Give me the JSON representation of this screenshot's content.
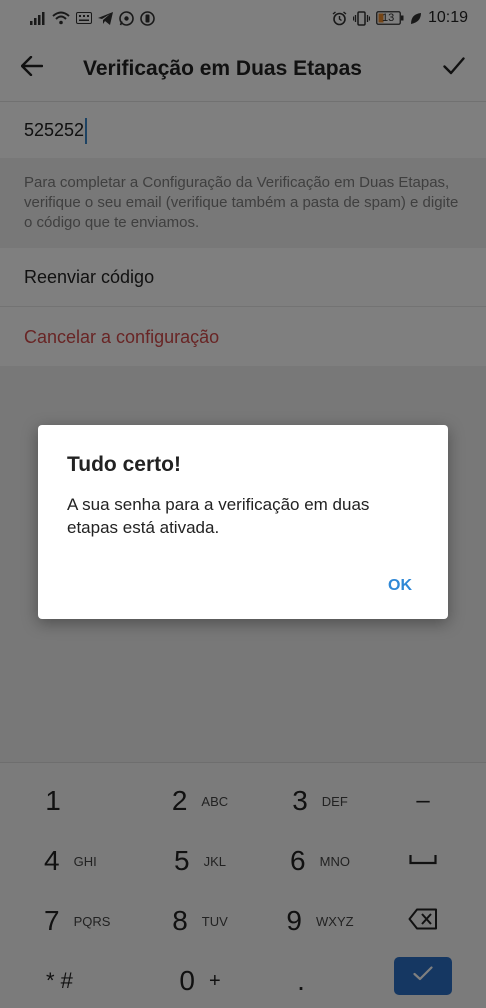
{
  "status_bar": {
    "battery": "13",
    "time": "10:19"
  },
  "app_bar": {
    "title": "Verificação em Duas Etapas"
  },
  "code_field": {
    "value": "525252"
  },
  "info_text": "Para completar a Configuração da Verificação em Duas Etapas, verifique o seu email (verifique também a pasta de spam) e digite o código que te enviamos.",
  "actions": {
    "resend": "Reenviar código",
    "cancel": "Cancelar a configuração"
  },
  "dialog": {
    "title": "Tudo certo!",
    "message": "A sua senha para a verificação em duas etapas está ativada.",
    "ok": "OK"
  },
  "keyboard": {
    "keys": [
      {
        "num": "1",
        "letters": ""
      },
      {
        "num": "2",
        "letters": "ABC"
      },
      {
        "num": "3",
        "letters": "DEF"
      },
      {
        "num": "–",
        "letters": ""
      },
      {
        "num": "4",
        "letters": "GHI"
      },
      {
        "num": "5",
        "letters": "JKL"
      },
      {
        "num": "6",
        "letters": "MNO"
      },
      {
        "num": "7",
        "letters": "PQRS"
      },
      {
        "num": "8",
        "letters": "TUV"
      },
      {
        "num": "9",
        "letters": "WXYZ"
      },
      {
        "num": "* #",
        "letters": ""
      },
      {
        "num": "0",
        "letters": "+"
      },
      {
        "num": ".",
        "letters": ""
      }
    ]
  },
  "colors": {
    "accent": "#2f88d6",
    "danger": "#d14a4a",
    "keyboard_ok": "#2b6ec5"
  },
  "icons": [
    "signal-icon",
    "wifi-icon",
    "keyboard-icon",
    "telegram-icon",
    "whatsapp-icon",
    "notification-icon",
    "alarm-icon",
    "vibrate-icon",
    "battery-icon",
    "leaf-icon",
    "back-arrow-icon",
    "check-icon",
    "space-icon",
    "backspace-icon"
  ]
}
